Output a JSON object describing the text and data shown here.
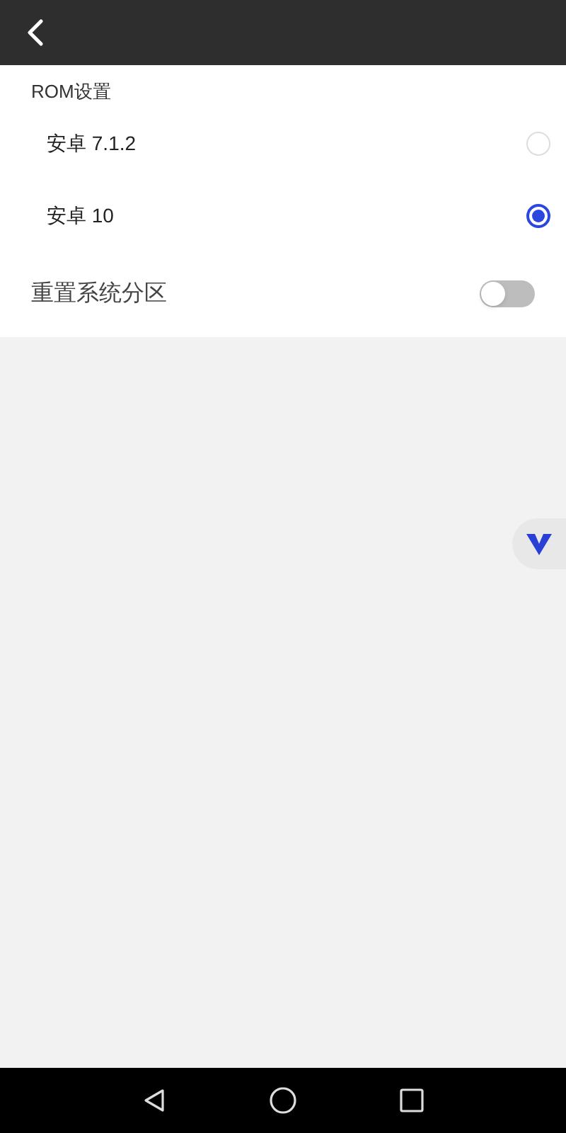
{
  "section": {
    "title": "ROM设置"
  },
  "rom_options": [
    {
      "label": "安卓 7.1.2",
      "selected": false
    },
    {
      "label": "安卓 10",
      "selected": true
    }
  ],
  "reset_partition": {
    "label": "重置系统分区",
    "on": false
  }
}
